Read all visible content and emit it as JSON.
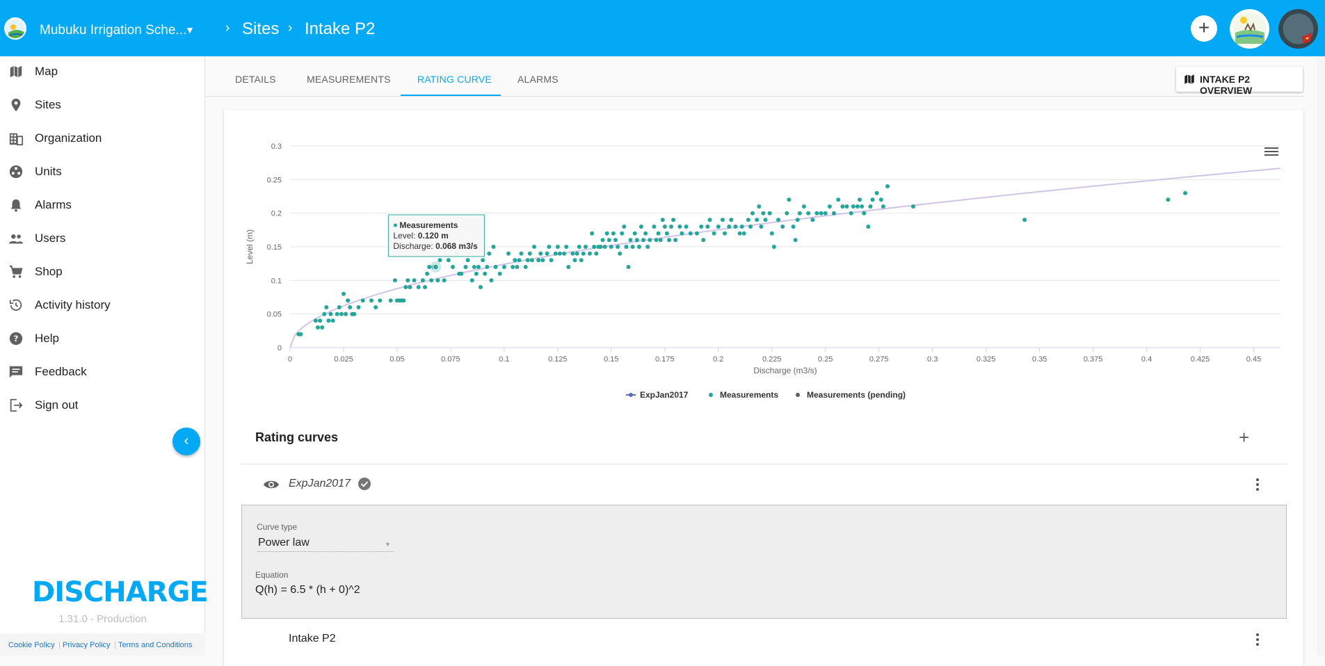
{
  "header": {
    "org_name": "Mubuku Irrigation Sche...",
    "breadcrumb": [
      "Sites",
      "Intake P2"
    ],
    "accent": "#03a9f4"
  },
  "sidebar": {
    "items": [
      {
        "label": "Map",
        "icon": "map-icon"
      },
      {
        "label": "Sites",
        "icon": "location-pin-icon"
      },
      {
        "label": "Organization",
        "icon": "building-icon"
      },
      {
        "label": "Units",
        "icon": "units-icon"
      },
      {
        "label": "Alarms",
        "icon": "bell-icon"
      },
      {
        "label": "Users",
        "icon": "users-icon"
      },
      {
        "label": "Shop",
        "icon": "cart-icon"
      },
      {
        "label": "Activity history",
        "icon": "history-icon"
      },
      {
        "label": "Help",
        "icon": "help-icon"
      },
      {
        "label": "Feedback",
        "icon": "feedback-icon"
      },
      {
        "label": "Sign out",
        "icon": "sign-out-icon"
      }
    ],
    "brand": "DISCHARGE",
    "version": "1.31.0 - Production",
    "footer_links": [
      "Cookie Policy",
      "Privacy Policy",
      "Terms and Conditions"
    ]
  },
  "tabs": {
    "items": [
      "DETAILS",
      "MEASUREMENTS",
      "RATING CURVE",
      "ALARMS"
    ],
    "active": "RATING CURVE",
    "overview_button": "INTAKE P2 OVERVIEW"
  },
  "chart_data": {
    "type": "scatter",
    "xlabel": "Discharge (m3/s)",
    "ylabel": "Level (m)",
    "xlim": [
      0,
      0.46
    ],
    "ylim": [
      0,
      0.3
    ],
    "x_ticks": [
      "0",
      "0.025",
      "0.05",
      "0.075",
      "0.1",
      "0.125",
      "0.15",
      "0.175",
      "0.2",
      "0.225",
      "0.25",
      "0.275",
      "0.3",
      "0.325",
      "0.35",
      "0.375",
      "0.4",
      "0.425",
      "0.45"
    ],
    "y_ticks": [
      "0",
      "0.05",
      "0.1",
      "0.15",
      "0.2",
      "0.25",
      "0.3"
    ],
    "grid": true,
    "legend": [
      {
        "name": "ExpJan2017",
        "color": "#5c6bc0"
      },
      {
        "name": "Measurements",
        "color": "#26a69a"
      },
      {
        "name": "Measurements (pending)",
        "color": "#616161"
      }
    ],
    "legend_position": "bottom",
    "curve": {
      "name": "ExpJan2017",
      "equation": "Q(h) = 6.5 * (h + 0)^2",
      "color": "#d1c4e9"
    },
    "measurement_color": "#26a69a",
    "tooltip": {
      "series": "Measurements",
      "level_label": "Level: ",
      "level_value": "0.120 m",
      "discharge_label": "Discharge: ",
      "discharge_value": "0.068 m3/s",
      "x": 0.068,
      "y": 0.12
    },
    "points": [
      [
        0.004,
        0.02
      ],
      [
        0.005,
        0.02
      ],
      [
        0.012,
        0.04
      ],
      [
        0.013,
        0.03
      ],
      [
        0.014,
        0.04
      ],
      [
        0.015,
        0.03
      ],
      [
        0.016,
        0.05
      ],
      [
        0.017,
        0.06
      ],
      [
        0.018,
        0.04
      ],
      [
        0.019,
        0.05
      ],
      [
        0.02,
        0.04
      ],
      [
        0.022,
        0.05
      ],
      [
        0.023,
        0.06
      ],
      [
        0.024,
        0.05
      ],
      [
        0.025,
        0.08
      ],
      [
        0.026,
        0.05
      ],
      [
        0.027,
        0.07
      ],
      [
        0.028,
        0.06
      ],
      [
        0.029,
        0.05
      ],
      [
        0.03,
        0.05
      ],
      [
        0.032,
        0.06
      ],
      [
        0.034,
        0.07
      ],
      [
        0.038,
        0.07
      ],
      [
        0.04,
        0.06
      ],
      [
        0.042,
        0.07
      ],
      [
        0.047,
        0.07
      ],
      [
        0.049,
        0.1
      ],
      [
        0.05,
        0.07
      ],
      [
        0.051,
        0.07
      ],
      [
        0.052,
        0.07
      ],
      [
        0.053,
        0.07
      ],
      [
        0.054,
        0.09
      ],
      [
        0.055,
        0.1
      ],
      [
        0.056,
        0.09
      ],
      [
        0.058,
        0.1
      ],
      [
        0.06,
        0.09
      ],
      [
        0.062,
        0.1
      ],
      [
        0.063,
        0.09
      ],
      [
        0.064,
        0.11
      ],
      [
        0.065,
        0.12
      ],
      [
        0.066,
        0.1
      ],
      [
        0.067,
        0.12
      ],
      [
        0.068,
        0.12
      ],
      [
        0.069,
        0.1
      ],
      [
        0.07,
        0.13
      ],
      [
        0.072,
        0.1
      ],
      [
        0.074,
        0.13
      ],
      [
        0.076,
        0.12
      ],
      [
        0.078,
        0.14
      ],
      [
        0.079,
        0.11
      ],
      [
        0.08,
        0.11
      ],
      [
        0.082,
        0.12
      ],
      [
        0.083,
        0.13
      ],
      [
        0.085,
        0.1
      ],
      [
        0.086,
        0.12
      ],
      [
        0.087,
        0.11
      ],
      [
        0.088,
        0.12
      ],
      [
        0.089,
        0.09
      ],
      [
        0.09,
        0.13
      ],
      [
        0.091,
        0.11
      ],
      [
        0.092,
        0.12
      ],
      [
        0.093,
        0.14
      ],
      [
        0.094,
        0.1
      ],
      [
        0.095,
        0.15
      ],
      [
        0.096,
        0.12
      ],
      [
        0.098,
        0.11
      ],
      [
        0.1,
        0.12
      ],
      [
        0.102,
        0.14
      ],
      [
        0.104,
        0.12
      ],
      [
        0.105,
        0.13
      ],
      [
        0.106,
        0.12
      ],
      [
        0.107,
        0.13
      ],
      [
        0.108,
        0.14
      ],
      [
        0.11,
        0.12
      ],
      [
        0.111,
        0.13
      ],
      [
        0.112,
        0.14
      ],
      [
        0.113,
        0.13
      ],
      [
        0.114,
        0.15
      ],
      [
        0.116,
        0.13
      ],
      [
        0.117,
        0.14
      ],
      [
        0.118,
        0.13
      ],
      [
        0.12,
        0.14
      ],
      [
        0.121,
        0.15
      ],
      [
        0.122,
        0.13
      ],
      [
        0.124,
        0.14
      ],
      [
        0.125,
        0.15
      ],
      [
        0.126,
        0.14
      ],
      [
        0.128,
        0.14
      ],
      [
        0.129,
        0.15
      ],
      [
        0.13,
        0.12
      ],
      [
        0.132,
        0.14
      ],
      [
        0.133,
        0.13
      ],
      [
        0.134,
        0.14
      ],
      [
        0.135,
        0.15
      ],
      [
        0.136,
        0.13
      ],
      [
        0.137,
        0.14
      ],
      [
        0.138,
        0.15
      ],
      [
        0.14,
        0.14
      ],
      [
        0.141,
        0.17
      ],
      [
        0.142,
        0.15
      ],
      [
        0.143,
        0.14
      ],
      [
        0.144,
        0.15
      ],
      [
        0.145,
        0.15
      ],
      [
        0.146,
        0.16
      ],
      [
        0.147,
        0.15
      ],
      [
        0.148,
        0.17
      ],
      [
        0.149,
        0.16
      ],
      [
        0.15,
        0.15
      ],
      [
        0.151,
        0.17
      ],
      [
        0.152,
        0.16
      ],
      [
        0.153,
        0.15
      ],
      [
        0.154,
        0.14
      ],
      [
        0.155,
        0.17
      ],
      [
        0.156,
        0.18
      ],
      [
        0.157,
        0.15
      ],
      [
        0.158,
        0.12
      ],
      [
        0.159,
        0.16
      ],
      [
        0.16,
        0.15
      ],
      [
        0.161,
        0.17
      ],
      [
        0.162,
        0.16
      ],
      [
        0.163,
        0.15
      ],
      [
        0.164,
        0.18
      ],
      [
        0.165,
        0.16
      ],
      [
        0.166,
        0.17
      ],
      [
        0.167,
        0.15
      ],
      [
        0.168,
        0.16
      ],
      [
        0.17,
        0.18
      ],
      [
        0.171,
        0.16
      ],
      [
        0.172,
        0.17
      ],
      [
        0.173,
        0.16
      ],
      [
        0.174,
        0.19
      ],
      [
        0.175,
        0.18
      ],
      [
        0.176,
        0.17
      ],
      [
        0.177,
        0.16
      ],
      [
        0.178,
        0.18
      ],
      [
        0.179,
        0.19
      ],
      [
        0.18,
        0.16
      ],
      [
        0.182,
        0.18
      ],
      [
        0.183,
        0.17
      ],
      [
        0.185,
        0.18
      ],
      [
        0.187,
        0.17
      ],
      [
        0.19,
        0.17
      ],
      [
        0.192,
        0.18
      ],
      [
        0.193,
        0.16
      ],
      [
        0.195,
        0.18
      ],
      [
        0.196,
        0.19
      ],
      [
        0.198,
        0.17
      ],
      [
        0.2,
        0.18
      ],
      [
        0.202,
        0.19
      ],
      [
        0.203,
        0.17
      ],
      [
        0.205,
        0.18
      ],
      [
        0.206,
        0.19
      ],
      [
        0.208,
        0.18
      ],
      [
        0.21,
        0.17
      ],
      [
        0.211,
        0.18
      ],
      [
        0.212,
        0.17
      ],
      [
        0.214,
        0.19
      ],
      [
        0.215,
        0.18
      ],
      [
        0.216,
        0.2
      ],
      [
        0.218,
        0.19
      ],
      [
        0.219,
        0.21
      ],
      [
        0.22,
        0.18
      ],
      [
        0.221,
        0.2
      ],
      [
        0.222,
        0.19
      ],
      [
        0.224,
        0.2
      ],
      [
        0.225,
        0.17
      ],
      [
        0.226,
        0.15
      ],
      [
        0.228,
        0.19
      ],
      [
        0.23,
        0.18
      ],
      [
        0.232,
        0.2
      ],
      [
        0.233,
        0.22
      ],
      [
        0.235,
        0.18
      ],
      [
        0.236,
        0.16
      ],
      [
        0.237,
        0.19
      ],
      [
        0.238,
        0.2
      ],
      [
        0.24,
        0.21
      ],
      [
        0.242,
        0.2
      ],
      [
        0.244,
        0.19
      ],
      [
        0.246,
        0.2
      ],
      [
        0.248,
        0.2
      ],
      [
        0.25,
        0.2
      ],
      [
        0.252,
        0.21
      ],
      [
        0.254,
        0.2
      ],
      [
        0.256,
        0.22
      ],
      [
        0.258,
        0.21
      ],
      [
        0.26,
        0.21
      ],
      [
        0.262,
        0.2
      ],
      [
        0.263,
        0.21
      ],
      [
        0.265,
        0.21
      ],
      [
        0.266,
        0.22
      ],
      [
        0.267,
        0.21
      ],
      [
        0.268,
        0.2
      ],
      [
        0.27,
        0.18
      ],
      [
        0.271,
        0.21
      ],
      [
        0.272,
        0.22
      ],
      [
        0.274,
        0.23
      ],
      [
        0.276,
        0.22
      ],
      [
        0.277,
        0.21
      ],
      [
        0.279,
        0.24
      ],
      [
        0.291,
        0.21
      ],
      [
        0.343,
        0.19
      ],
      [
        0.41,
        0.22
      ],
      [
        0.418,
        0.23
      ]
    ]
  },
  "rating_curves": {
    "title": "Rating curves",
    "curve_name": "ExpJan2017",
    "curve_type_label": "Curve type",
    "curve_type_value": "Power law",
    "equation_label": "Equation",
    "equation_value": "Q(h) = 6.5 * (h + 0)^2",
    "site_name": "Intake P2"
  }
}
